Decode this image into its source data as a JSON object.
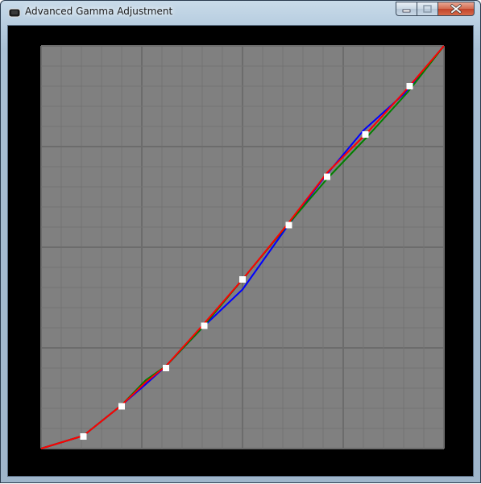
{
  "window": {
    "title": "Advanced Gamma Adjustment",
    "buttons": {
      "minimize": "minimize-icon",
      "maximize": "maximize-icon",
      "close": "close-icon"
    }
  },
  "colors": {
    "client_bg": "#000000",
    "plot_bg": "#808080",
    "grid_major": "#6c6c6c",
    "grid_minor": "#737373",
    "red": "#ff0000",
    "green": "#008000",
    "blue": "#0000ff",
    "handle": "#ffffff"
  },
  "chart_data": {
    "type": "line",
    "title": "",
    "xlabel": "",
    "ylabel": "",
    "xlim": [
      0,
      1
    ],
    "ylim": [
      0,
      1
    ],
    "grid": true,
    "grid_major_divisions": 4,
    "grid_minor_divisions": 20,
    "series": [
      {
        "color": "blue",
        "x": [
          0,
          0.105,
          0.2,
          0.26,
          0.31,
          0.4,
          0.5,
          0.61,
          0.7,
          0.8,
          0.9,
          1
        ],
        "y": [
          0,
          0.032,
          0.108,
          0.16,
          0.205,
          0.3,
          0.395,
          0.55,
          0.67,
          0.79,
          0.88,
          1
        ]
      },
      {
        "color": "green",
        "x": [
          0,
          0.105,
          0.2,
          0.26,
          0.31,
          0.4,
          0.5,
          0.61,
          0.71,
          0.81,
          0.91,
          1
        ],
        "y": [
          0,
          0.032,
          0.108,
          0.17,
          0.205,
          0.3,
          0.42,
          0.553,
          0.67,
          0.775,
          0.885,
          1
        ]
      },
      {
        "color": "red",
        "x": [
          0,
          0.105,
          0.2,
          0.26,
          0.31,
          0.4,
          0.5,
          0.61,
          0.71,
          0.81,
          0.91,
          1
        ],
        "y": [
          0,
          0.032,
          0.108,
          0.165,
          0.205,
          0.305,
          0.42,
          0.555,
          0.685,
          0.785,
          0.895,
          1
        ]
      }
    ],
    "control_points": {
      "x": [
        0.105,
        0.2,
        0.31,
        0.405,
        0.5,
        0.615,
        0.71,
        0.805,
        0.915
      ],
      "y": [
        0.03,
        0.105,
        0.2,
        0.305,
        0.42,
        0.555,
        0.675,
        0.78,
        0.9
      ]
    }
  }
}
